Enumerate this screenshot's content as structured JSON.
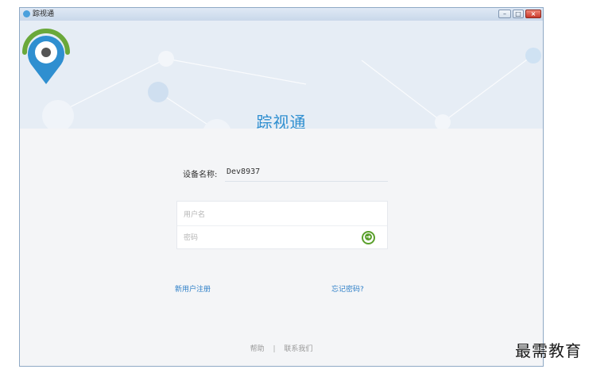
{
  "window": {
    "title": "踪视通",
    "controls": {
      "minimize": "–",
      "maximize": "□",
      "close": "×"
    }
  },
  "header": {
    "brand": "踪视通",
    "logo_icon": "location-pin-icon"
  },
  "colors": {
    "accent": "#2f8fd0",
    "go_button": "#5aa02c",
    "link": "#2f80c8",
    "logo_arc": "#6aa83a"
  },
  "login": {
    "device_label": "设备名称:",
    "device_value": "Dev8937",
    "username_placeholder": "用户名",
    "password_placeholder": "密码",
    "submit_icon": "arrow-right-circle-icon",
    "submit_glyph": "➜"
  },
  "links": {
    "register": "新用户注册",
    "forgot": "忘记密码?"
  },
  "footer": {
    "help": "帮助",
    "separator": "|",
    "contact": "联系我们"
  },
  "watermark": "最需教育"
}
